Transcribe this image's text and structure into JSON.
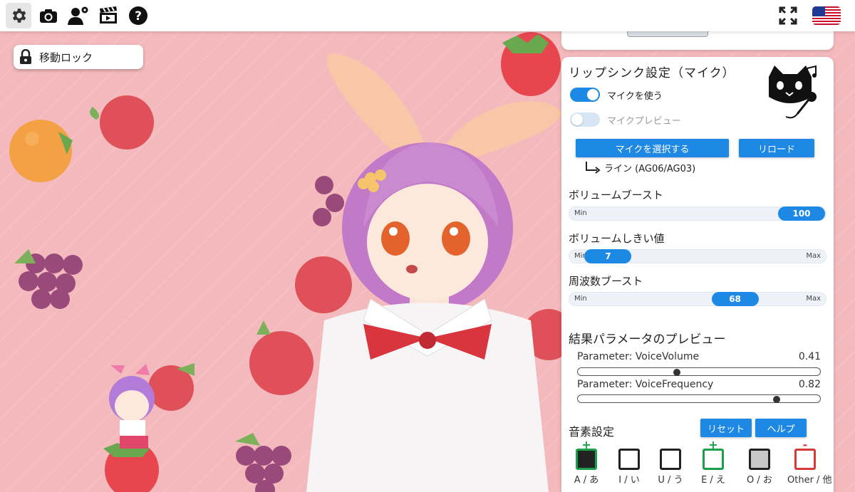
{
  "toolbar": {
    "icons": [
      "gear-icon",
      "camera-icon",
      "user-settings-icon",
      "clapperboard-icon",
      "help-icon",
      "fullscreen-icon",
      "us-flag-icon"
    ]
  },
  "lock": {
    "label": "移動ロック",
    "icon": "lock-icon"
  },
  "panel": {
    "title": "リップシンク設定（マイク）",
    "mascot_icon": "cat-microphone-icon",
    "use_mic": {
      "label": "マイクを使う",
      "on": true
    },
    "mic_preview": {
      "label": "マイクプレビュー",
      "on": false
    },
    "select_mic_button": "マイクを選択する",
    "reload_button": "リロード",
    "device_name": "ライン (AG06/AG03)",
    "volume_boost": {
      "label": "ボリュームブースト",
      "min_label": "Min",
      "max_label": "",
      "value": "100",
      "fraction": 1.0
    },
    "volume_threshold": {
      "label": "ボリュームしきい値",
      "min_label": "Min",
      "max_label": "Max",
      "value": "7",
      "fraction": 0.07
    },
    "frequency_boost": {
      "label": "周波数ブースト",
      "min_label": "Min",
      "max_label": "Max",
      "value": "68",
      "fraction": 0.68
    },
    "preview_title": "結果パラメータのプレビュー",
    "params": [
      {
        "name": "Parameter:  VoiceVolume",
        "value": "0.41",
        "fraction": 0.41
      },
      {
        "name": "Parameter:  VoiceFrequency",
        "value": "0.82",
        "fraction": 0.82
      }
    ],
    "phoneme_title": "音素設定",
    "reset_button": "リセット",
    "help_button": "ヘルプ",
    "phonemes": [
      {
        "label": "A / あ",
        "mark": "+",
        "mark_color": "#1aa04a",
        "box_border": "#1aa04a",
        "box_fill": "#222222"
      },
      {
        "label": "I / い",
        "mark": "",
        "mark_color": "",
        "box_border": "#222222",
        "box_fill": "#ffffff"
      },
      {
        "label": "U / う",
        "mark": "",
        "mark_color": "",
        "box_border": "#222222",
        "box_fill": "#ffffff"
      },
      {
        "label": "E / え",
        "mark": "+",
        "mark_color": "#1aa04a",
        "box_border": "#1aa04a",
        "box_fill": "#ffffff"
      },
      {
        "label": "O / お",
        "mark": "",
        "mark_color": "",
        "box_border": "#222222",
        "box_fill": "#c8c8c8"
      },
      {
        "label": "Other / 他",
        "mark": "-",
        "mark_color": "#d83a3a",
        "box_border": "#d83a3a",
        "box_fill": "#ffffff"
      }
    ]
  },
  "colors": {
    "accent": "#1e88e5",
    "background": "#f4b9bc"
  }
}
